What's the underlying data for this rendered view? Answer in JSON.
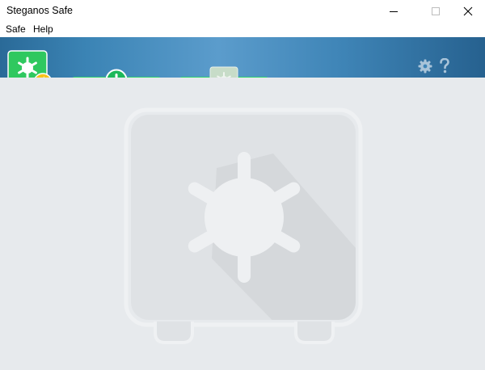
{
  "window": {
    "title": "Steganos Safe",
    "controls": [
      "minimize",
      "maximize",
      "close"
    ]
  },
  "menu": {
    "items": [
      {
        "label": "Safe"
      },
      {
        "label": "Help"
      }
    ]
  },
  "toolbar": {
    "icons": [
      "safe-badge-lightning-icon",
      "add-icon",
      "safe-icon",
      "gear-icon",
      "help-icon"
    ]
  },
  "colors": {
    "banner": "#3b84b5",
    "step_green": "#2ed36c",
    "badge_yellow": "#f7c21a",
    "background": "#e7eaed"
  }
}
